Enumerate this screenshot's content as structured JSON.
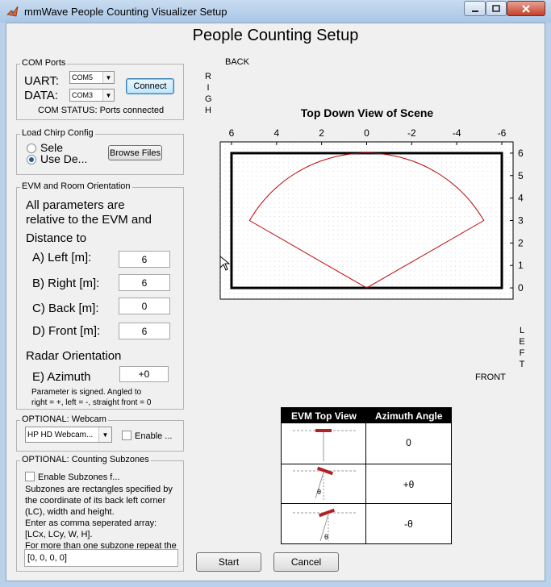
{
  "window": {
    "title": "mmWave People Counting Visualizer Setup"
  },
  "page_title": "People Counting Setup",
  "com_ports": {
    "title": "COM Ports",
    "uart_label": "UART:",
    "uart_value": "COM5",
    "data_label": "DATA:",
    "data_value": "COM3",
    "connect_label": "Connect",
    "status": "COM STATUS: Ports connected"
  },
  "chirp": {
    "title": "Load Chirp Config",
    "option_select": "Sele",
    "option_default": "Use De...",
    "browse_label": "Browse Files"
  },
  "evm": {
    "title": "EVM and Room Orientation",
    "desc_line1": "All parameters are",
    "desc_line2": "relative to the EVM and",
    "distance_to": "Distance to",
    "left_label": "A) Left [m]:",
    "left_value": "6",
    "right_label": "B) Right [m]:",
    "right_value": "6",
    "back_label": "C) Back [m]:",
    "back_value": "0",
    "front_label": "D) Front [m]:",
    "front_value": "6",
    "radar_orientation": "Radar Orientation",
    "azimuth_label": "E) Azimuth",
    "azimuth_value": "+0",
    "note_line1": "Parameter is signed. Angled to",
    "note_line2": "right = +, left = -, straight front = 0"
  },
  "webcam": {
    "title": "OPTIONAL: Webcam",
    "camera_value": "HP HD Webcam...",
    "enable_label": "Enable ..."
  },
  "subzones": {
    "title": "OPTIONAL: Counting Subzones",
    "enable_label": "Enable Subzones f...",
    "desc": [
      "Subzones are rectangles specified by",
      "the coordinate of its back left corner",
      "(LC), width and height.",
      "Enter as comma seperated array:",
      "[LCx, LCy, W, H].",
      "For more than one subzone repeat the"
    ],
    "input_value": "[0, 0, 0, 0]"
  },
  "scene": {
    "back_label": "BACK",
    "front_label": "FRONT",
    "right_vertical": [
      "R",
      "I",
      "G",
      "H"
    ],
    "left_vertical": [
      "L",
      "E",
      "F",
      "T"
    ]
  },
  "chart_data": {
    "type": "scatter",
    "title": "Top Down View of Scene",
    "xlabel": "",
    "ylabel": "",
    "x_ticks": [
      6,
      4,
      2,
      0,
      -2,
      -4,
      -6
    ],
    "y_ticks": [
      0,
      1,
      2,
      3,
      4,
      5,
      6
    ],
    "xlim": [
      6.5,
      -6.5
    ],
    "ylim": [
      6.5,
      -0.5
    ],
    "x_axis_position": "top",
    "y_axis_position": "right",
    "grid": "dotted",
    "room_rect": {
      "x": [
        -6,
        6
      ],
      "y": [
        0,
        6
      ],
      "color": "#000000"
    },
    "coverage": {
      "color": "#c00000",
      "points": [
        [
          0,
          0
        ],
        [
          5.2,
          3.0
        ],
        [
          0,
          6.0
        ],
        [
          -5.2,
          3.0
        ],
        [
          0,
          0
        ]
      ]
    }
  },
  "azimuth_table": {
    "col1": "EVM Top View",
    "col2": "Azimuth Angle",
    "rows": [
      "0",
      "+θ",
      "-θ"
    ],
    "theta_symbol": "θ"
  },
  "buttons": {
    "start": "Start",
    "cancel": "Cancel"
  },
  "colors": {
    "accent": "#3399ff",
    "coverage": "#c00000",
    "evm_bar": "#b22222"
  }
}
